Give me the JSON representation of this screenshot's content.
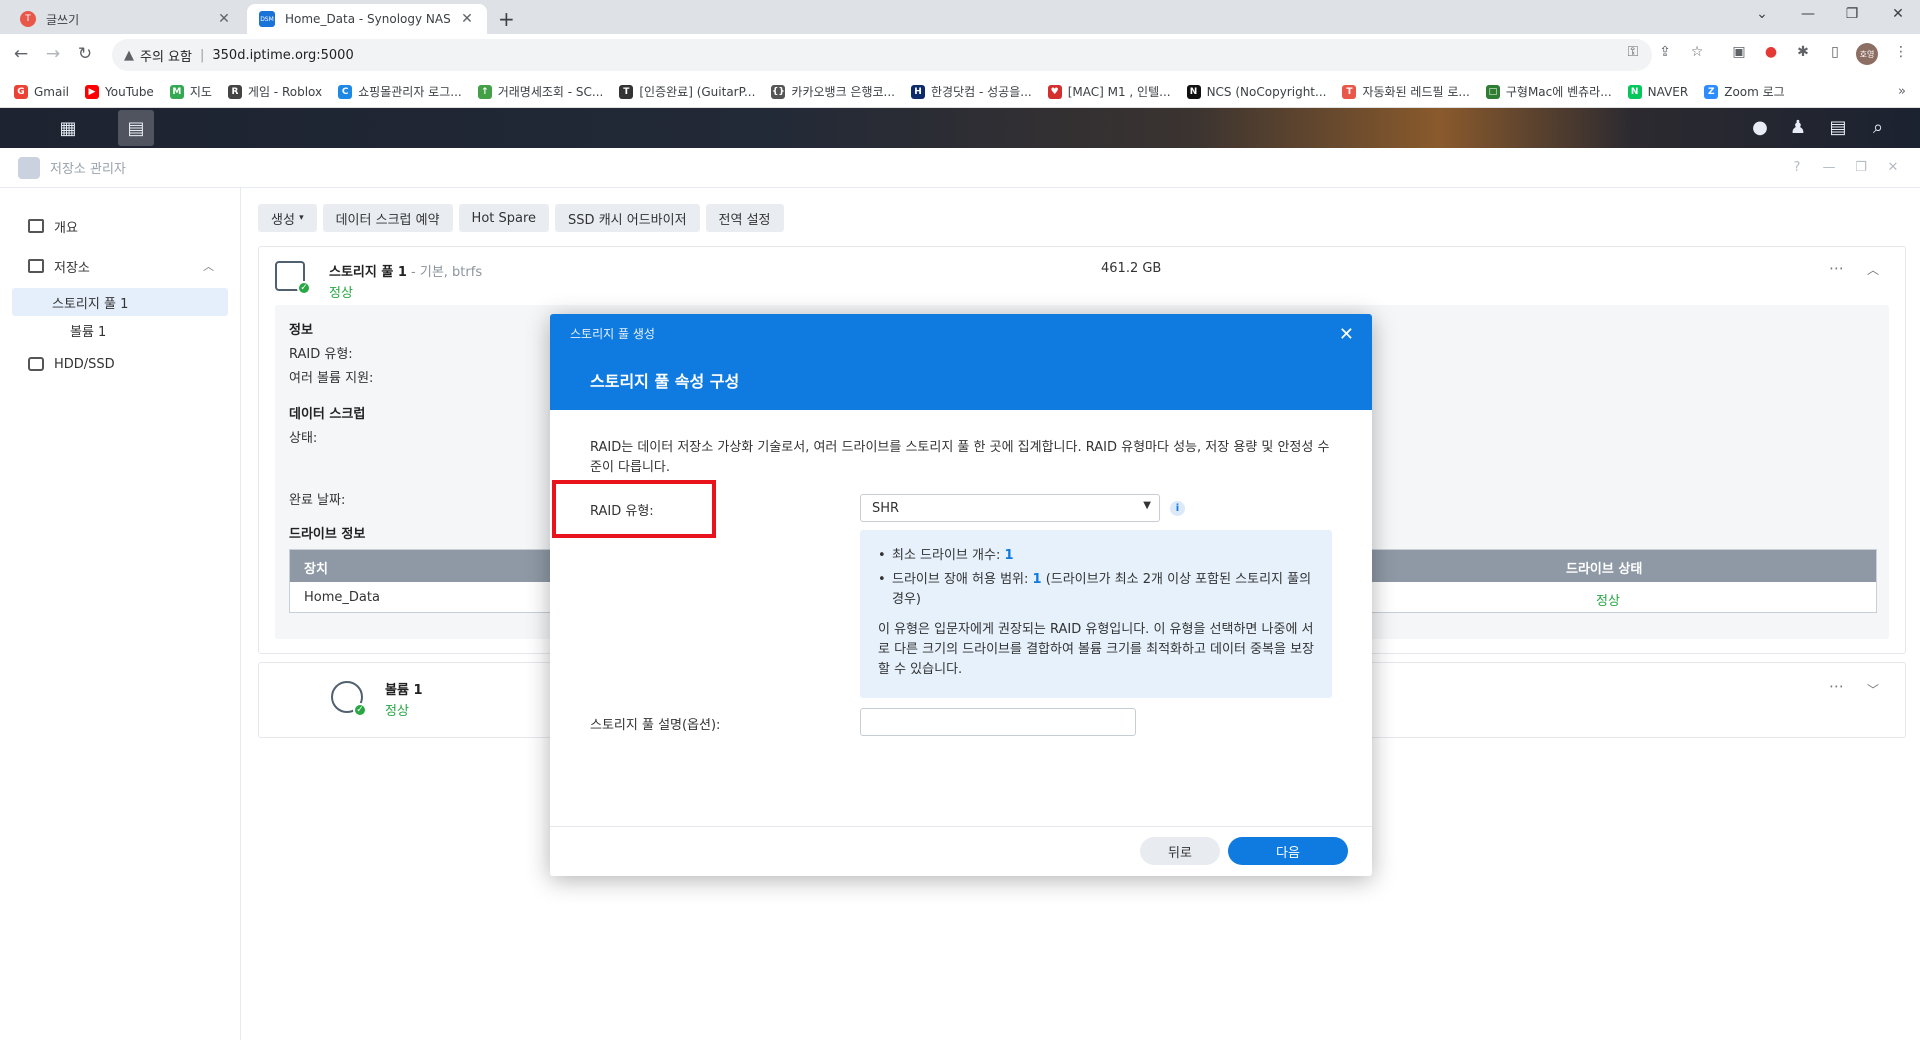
{
  "browser": {
    "tabs": [
      {
        "title": "글쓰기",
        "active": false
      },
      {
        "title": "Home_Data - Synology NAS",
        "active": true,
        "favicon": "DSM"
      }
    ],
    "address": {
      "warning": "주의 요함",
      "url": "350d.iptime.org:5000"
    },
    "profile_initials": "호영",
    "bookmarks": [
      {
        "label": "Gmail",
        "icon_color": "#ea4335",
        "icon_text": "G"
      },
      {
        "label": "YouTube",
        "icon_color": "#ff0000",
        "icon_text": "▶"
      },
      {
        "label": "지도",
        "icon_color": "#34a853",
        "icon_text": "M"
      },
      {
        "label": "게임 - Roblox",
        "icon_color": "#444444",
        "icon_text": "R"
      },
      {
        "label": "쇼핑몰관리자 로그...",
        "icon_color": "#1e88e5",
        "icon_text": "C"
      },
      {
        "label": "거래명세조회 - SC...",
        "icon_color": "#43a047",
        "icon_text": "↑"
      },
      {
        "label": "[인증완료] (GuitarP...",
        "icon_color": "#333333",
        "icon_text": "T"
      },
      {
        "label": "카카오뱅크 은행코...",
        "icon_color": "#555555",
        "icon_text": "{}"
      },
      {
        "label": "한경닷컴 - 성공을...",
        "icon_color": "#0d2a6b",
        "icon_text": "H"
      },
      {
        "label": "[MAC] M1 , 인텔...",
        "icon_color": "#d32f2f",
        "icon_text": "♥"
      },
      {
        "label": "NCS (NoCopyright...",
        "icon_color": "#111111",
        "icon_text": "N"
      },
      {
        "label": "자동화된 레드필 로...",
        "icon_color": "#e8574a",
        "icon_text": "T"
      },
      {
        "label": "구형Mac에 벤츄라...",
        "icon_color": "#2e7d32",
        "icon_text": "□"
      },
      {
        "label": "NAVER",
        "icon_color": "#03c75a",
        "icon_text": "N"
      },
      {
        "label": "Zoom 로그",
        "icon_color": "#2d8cff",
        "icon_text": "Z"
      }
    ]
  },
  "app": {
    "title": "저장소 관리자",
    "sidebar": {
      "overview": "개요",
      "storage": "저장소",
      "pool": "스토리지 풀 1",
      "volume": "볼륨 1",
      "hdd": "HDD/SSD"
    },
    "toolbar": {
      "create": "생성",
      "scrub": "데이터 스크럽 예약",
      "hotspare": "Hot Spare",
      "ssd": "SSD 캐시 어드바이저",
      "global": "전역 설정"
    },
    "pool": {
      "name": "스토리지 풀 1",
      "meta": " - 기본, btrfs",
      "status": "정상",
      "size": "461.2 GB",
      "info_heading": "정보",
      "raid_type_label": "RAID 유형:",
      "multi_volume_label": "여러 볼륨 지원:",
      "scrub_heading": "데이터 스크럽",
      "scrub_status_label": "상태:",
      "complete_date_label": "완료 날짜:",
      "drive_info_heading": "드라이브 정보",
      "table": {
        "col_device": "장치",
        "col_status": "드라이브 상태",
        "device": "Home_Data",
        "status": "정상"
      }
    },
    "volume": {
      "name": "볼륨 1",
      "status": "정상"
    }
  },
  "dialog": {
    "header_small": "스토리지 풀 생성",
    "title": "스토리지 풀 속성 구성",
    "description": "RAID는 데이터 저장소 가상화 기술로서, 여러 드라이브를 스토리지 풀 한 곳에 집계합니다. RAID 유형마다 성능, 저장 용량 및 안정성 수준이 다릅니다.",
    "raid_label": "RAID 유형:",
    "raid_value": "SHR",
    "info": {
      "min_drives_label": "최소 드라이브 개수: ",
      "min_drives_value": "1",
      "fault_label": "드라이브 장애 허용 범위: ",
      "fault_value": "1",
      "fault_note": " (드라이브가 최소 2개 이상 포함된 스토리지 풀의 경우)",
      "paragraph": "이 유형은 입문자에게 권장되는 RAID 유형입니다. 이 유형을 선택하면 나중에 서로 다른 크기의 드라이브를 결합하여 볼륨 크기를 최적화하고 데이터 중복을 보장할 수 있습니다."
    },
    "desc_label": "스토리지 풀 설명(옵션):",
    "back": "뒤로",
    "next": "다음"
  }
}
